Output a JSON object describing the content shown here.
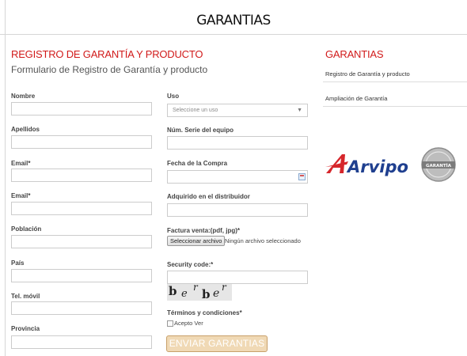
{
  "page": {
    "title": "GARANTIAS"
  },
  "form": {
    "title": "REGISTRO DE GARANTÍA Y PRODUCTO",
    "subtitle": "Formulario de Registro de Garantía y producto",
    "left_labels": [
      "Nombre",
      "Apellidos",
      "Email*",
      "Email*",
      "Población",
      "País",
      "Tel. móvil",
      "Provincia"
    ],
    "right": {
      "uso_label": "Uso",
      "uso_selected": "Seleccione un uso",
      "serie_label": "Núm. Serie del equipo",
      "fecha_label": "Fecha de la Compra",
      "distribuidor_label": "Adquirido en el distribuidor",
      "factura_label": "Factura venta:(pdf, jpg)*",
      "file_button": "Seleccionar archivo",
      "file_status": "Ningún archivo seleccionado",
      "security_label": "Security code:*",
      "captcha_text": "b e r b e r",
      "terms_label": "Términos y condiciones*",
      "accept_label": "Acepto Ver",
      "submit": "ENVIAR GARANTIAS"
    }
  },
  "sidebar": {
    "title": "GARANTIAS",
    "links": [
      "Registro de Garantía y producto",
      "Ampliación de Garantía"
    ],
    "logo_text": "Arvipo",
    "badge_text": "GARANTÍA"
  },
  "colors": {
    "accent": "#d11a1a",
    "button_bg": "#f0d9b5",
    "button_border": "#c8a06a"
  }
}
